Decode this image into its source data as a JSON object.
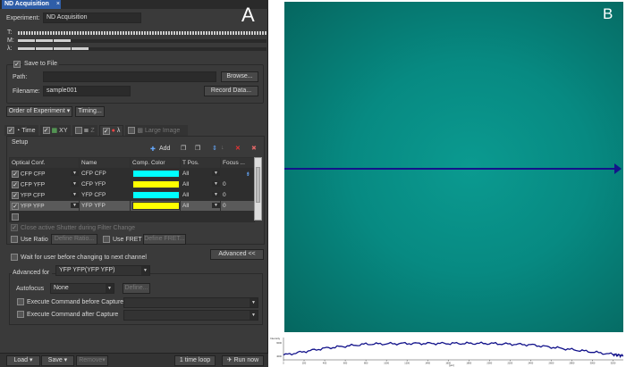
{
  "panel_label_a": "A",
  "panel_label_b": "B",
  "tab": {
    "title": "ND Acquisition",
    "close": "×"
  },
  "experiment": {
    "label": "Experiment:",
    "value": "ND Acquisition"
  },
  "progress": {
    "t_label": "T:",
    "m_label": "M:",
    "l_label": "λ:"
  },
  "save": {
    "label": "Save to File",
    "checked": true,
    "path_label": "Path:",
    "path_value": "",
    "browse": "Browse...",
    "filename_label": "Filename:",
    "filename_value": "sample001",
    "record": "Record Data..."
  },
  "order": {
    "label": "Order of Experiment ▾",
    "timing": "Timing..."
  },
  "dim_tabs": [
    {
      "label": "Time",
      "checked": true
    },
    {
      "label": "XY",
      "checked": true
    },
    {
      "label": "Z",
      "checked": false
    },
    {
      "label": "λ",
      "checked": true
    },
    {
      "label": "Large Image",
      "checked": false
    }
  ],
  "setup": {
    "title": "Setup",
    "add": "Add",
    "columns": [
      "Optical Conf.",
      "Name",
      "Comp. Color",
      "T Pos.",
      "Focus ..."
    ],
    "rows": [
      {
        "conf": "CFP CFP",
        "name": "CFP CFP",
        "color": "#00ffff",
        "tpos": "All",
        "focus": ""
      },
      {
        "conf": "CFP YFP",
        "name": "CFP YFP",
        "color": "#ffff00",
        "tpos": "All",
        "focus": "0"
      },
      {
        "conf": "YFP CFP",
        "name": "YFP CFP",
        "color": "#00ffff",
        "tpos": "All",
        "focus": "0"
      },
      {
        "conf": "YFP YFP",
        "name": "YFP YFP",
        "color": "#ffff00",
        "tpos": "All",
        "focus": "0"
      }
    ]
  },
  "close_shutter": "Close active Shutter during Filter Change",
  "use_ratio": "Use Ratio",
  "define_ratio": "Define Ratio...",
  "use_fret": "Use FRET",
  "define_fret": "Define FRET...",
  "wait_user": "Wait for user before changing to next channel",
  "advanced_btn": "Advanced <<",
  "advanced_for": {
    "label": "Advanced for",
    "value": "YFP YFP(YFP YFP)"
  },
  "autofocus": {
    "label": "Autofocus",
    "value": "None",
    "define": "Define..."
  },
  "exec_before": "Execute Command before Capture",
  "exec_after": "Execute Command after Capture",
  "bottom": {
    "load": "Load ▾",
    "save": "Save ▾",
    "remove": "Remove▾",
    "loop": "1 time loop",
    "run": "Run now"
  },
  "chart_data": {
    "type": "line",
    "title": "",
    "xlabel": "[µm]",
    "ylabel": "Intensity",
    "xlim": [
      0,
      3300
    ],
    "x_ticks": [
      "0",
      "200",
      "400",
      "600",
      "800",
      "1000",
      "1200",
      "1400",
      "1600",
      "1800",
      "2000",
      "2200",
      "2400",
      "2600",
      "2800",
      "3000",
      "3200"
    ],
    "y_ticks": [
      "6000",
      "4000"
    ],
    "series": [
      {
        "name": "profile",
        "color": "#10108a",
        "x": [
          0,
          400,
          800,
          1200,
          1600,
          2000,
          2400,
          2800,
          3200,
          3300
        ],
        "y": [
          4200,
          5200,
          5800,
          5900,
          5900,
          5900,
          5700,
          5000,
          4300,
          4100
        ]
      }
    ]
  }
}
